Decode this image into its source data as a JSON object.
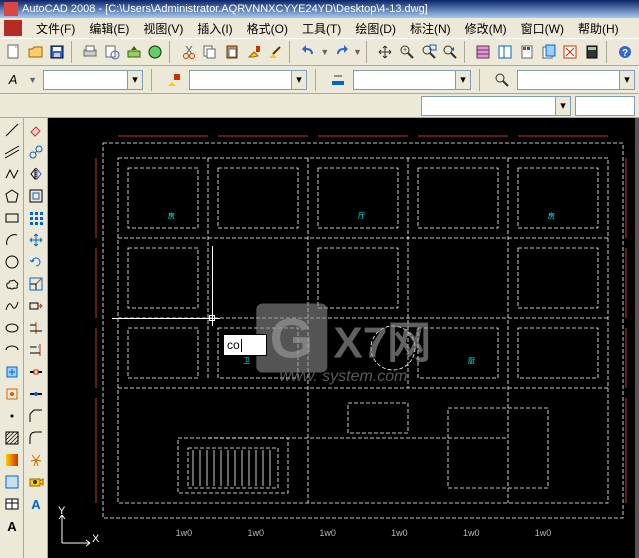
{
  "title": "AutoCAD 2008 - [C:\\Users\\Administrator.AQRVNNXCYYE24YD\\Desktop\\4-13.dwg]",
  "menu": {
    "file": "文件(F)",
    "edit": "编辑(E)",
    "view": "视图(V)",
    "insert": "插入(I)",
    "format": "格式(O)",
    "tools": "工具(T)",
    "draw": "绘图(D)",
    "dimension": "标注(N)",
    "modify": "修改(M)",
    "window": "窗口(W)",
    "help": "帮助(H)"
  },
  "toolbar1_icons": [
    "new",
    "open",
    "save",
    "plot",
    "plotpreview",
    "publish",
    "cut",
    "copy",
    "paste",
    "matchprop",
    "eraser",
    "pencil",
    "undo",
    "redo",
    "pan",
    "zoomrt",
    "zoomwin",
    "zoomprev",
    "props",
    "dcenter",
    "toolpal",
    "sheet",
    "markup",
    "calc",
    "help"
  ],
  "properties": {
    "textstyle_icon": "A",
    "layer_value": "",
    "linetype_value": "",
    "lineweight_value": "",
    "plotstyle_value": ""
  },
  "command_input": "co",
  "ucs": {
    "x": "X",
    "y": "Y"
  },
  "watermark": {
    "g": "G",
    "text": "X7网",
    "sub": "www. system.com"
  },
  "draw_palette": [
    "line",
    "cline",
    "pline",
    "polygon",
    "rect",
    "arc",
    "circle",
    "revcloud",
    "spline",
    "ellipse",
    "earc",
    "block",
    "point",
    "hatch",
    "grad",
    "region",
    "table",
    "mtext"
  ],
  "modify_palette": [
    "erase",
    "copy",
    "mirror",
    "offset",
    "array",
    "move",
    "rotate",
    "scale",
    "stretch",
    "trim",
    "extend",
    "break",
    "join",
    "chamfer",
    "fillet",
    "explode",
    "camera",
    "a-icon"
  ],
  "ruler_labels": [
    "1w0",
    "1w0",
    "1w0",
    "1w0",
    "1w0",
    "1w0"
  ],
  "colors": {
    "bg": "#000000",
    "drawing": "#ffffff",
    "dim": "#ff4040",
    "cyan": "#00ffff"
  }
}
